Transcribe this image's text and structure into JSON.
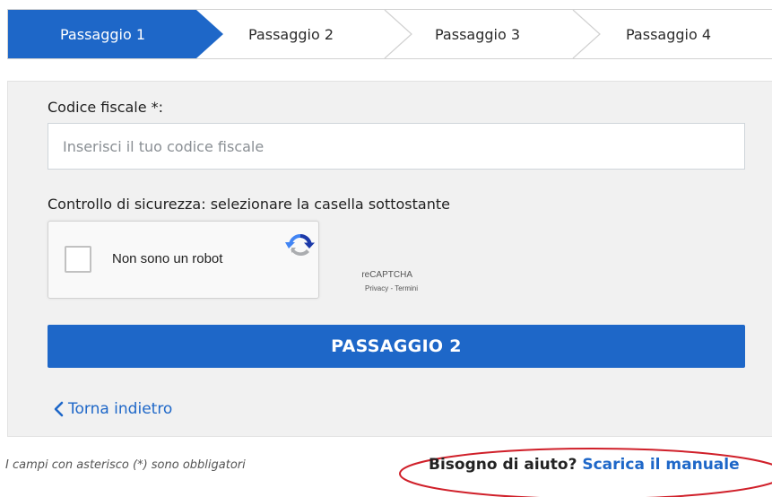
{
  "stepper": {
    "steps": [
      {
        "label": "Passaggio 1",
        "active": true
      },
      {
        "label": "Passaggio 2",
        "active": false
      },
      {
        "label": "Passaggio 3",
        "active": false
      },
      {
        "label": "Passaggio 4",
        "active": false
      }
    ]
  },
  "form": {
    "codice_label": "Codice fiscale *:",
    "codice_placeholder": "Inserisci il tuo codice fiscale",
    "codice_value": "",
    "security_label": "Controllo di sicurezza: selezionare la casella sottostante"
  },
  "captcha": {
    "text": "Non sono un robot",
    "checked": false,
    "brand": "reCAPTCHA",
    "links": "Privacy - Termini"
  },
  "actions": {
    "primary_label": "PASSAGGIO 2",
    "back_label": "Torna indietro"
  },
  "footer": {
    "required_note": "I campi con asterisco (*) sono obbligatori",
    "help_text": "Bisogno di aiuto?",
    "help_link": "Scarica il manuale"
  },
  "colors": {
    "accent": "#1e67c8",
    "panel_bg": "#f1f1f1",
    "highlight_oval": "#d0202a"
  },
  "icons": [
    "chevron-left-icon",
    "recaptcha-icon",
    "step-arrow-icon"
  ]
}
